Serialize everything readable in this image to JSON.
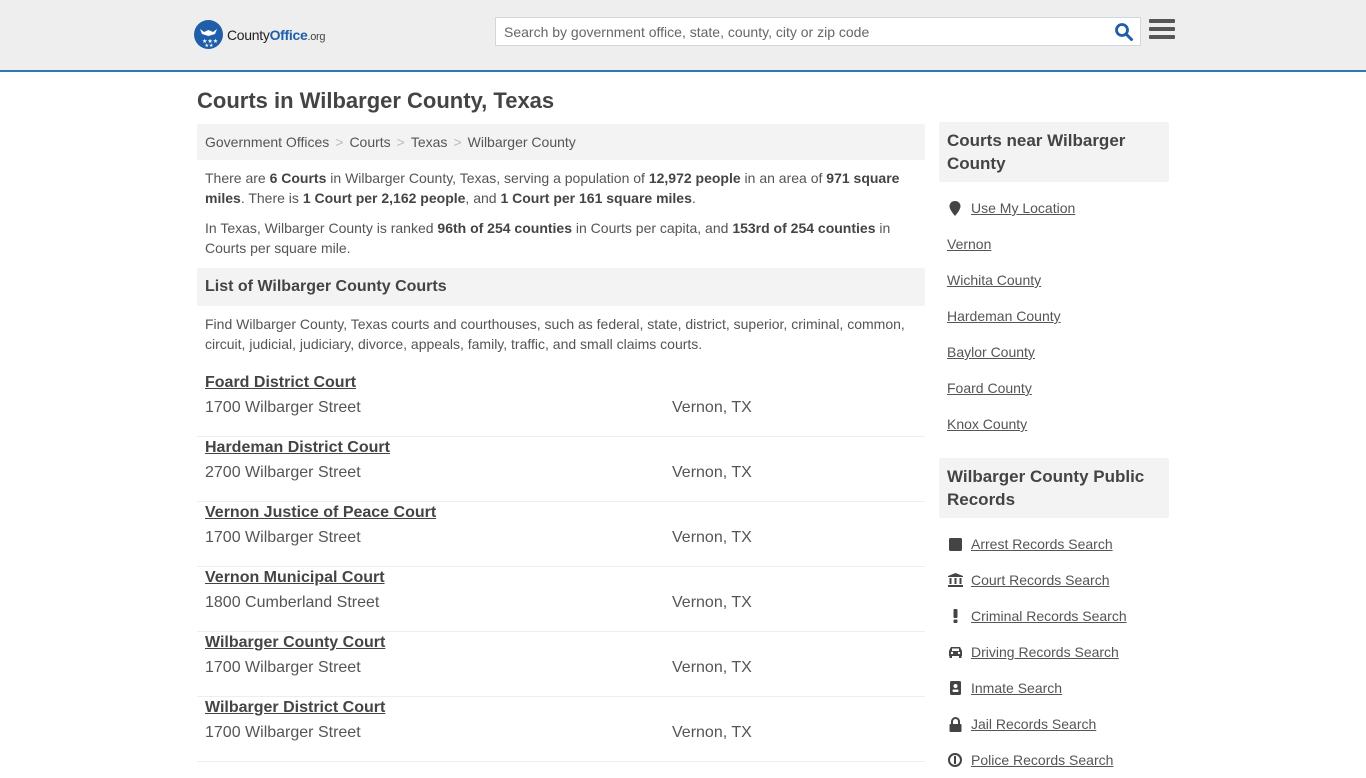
{
  "header": {
    "logo": {
      "county": "County",
      "office": "Office",
      "tld": ".org"
    },
    "search_placeholder": "Search by government office, state, county, city or zip code",
    "search_value": "",
    "brand_color": "#1f5ea8",
    "accent_line_color": "#2d78b5"
  },
  "page_title": "Courts in Wilbarger County, Texas",
  "breadcrumb": [
    {
      "label": "Government Offices"
    },
    {
      "label": "Courts"
    },
    {
      "label": "Texas"
    },
    {
      "label": "Wilbarger County"
    }
  ],
  "intro": {
    "p1": {
      "t1": "There are ",
      "b1": "6 Courts",
      "t2": " in Wilbarger County, Texas, serving a population of ",
      "b2": "12,972 people",
      "t3": " in an area of ",
      "b3": "971 square miles",
      "t4": ". There is ",
      "b4": "1 Court per 2,162 people",
      "t5": ", and ",
      "b5": "1 Court per 161 square miles",
      "t6": "."
    },
    "p2": {
      "t1": "In Texas, Wilbarger County is ranked ",
      "b1": "96th of 254 counties",
      "t2": " in Courts per capita, and ",
      "b2": "153rd of 254 counties",
      "t3": " in Courts per square mile."
    }
  },
  "list_section": {
    "heading": "List of Wilbarger County Courts",
    "description": "Find Wilbarger County, Texas courts and courthouses, such as federal, state, district, superior, criminal, common, circuit, judicial, judiciary, divorce, appeals, family, traffic, and small claims courts.",
    "courts": [
      {
        "name": "Foard District Court",
        "address": "1700 Wilbarger Street",
        "city": "Vernon, TX"
      },
      {
        "name": "Hardeman District Court",
        "address": "2700 Wilbarger Street",
        "city": "Vernon, TX"
      },
      {
        "name": "Vernon Justice of Peace Court",
        "address": "1700 Wilbarger Street",
        "city": "Vernon, TX"
      },
      {
        "name": "Vernon Municipal Court",
        "address": "1800 Cumberland Street",
        "city": "Vernon, TX"
      },
      {
        "name": "Wilbarger County Court",
        "address": "1700 Wilbarger Street",
        "city": "Vernon, TX"
      },
      {
        "name": "Wilbarger District Court",
        "address": "1700 Wilbarger Street",
        "city": "Vernon, TX"
      }
    ]
  },
  "sidebar": {
    "nearby": {
      "heading": "Courts near Wilbarger County",
      "use_location": {
        "label": "Use My Location",
        "icon": "map-marker-icon"
      },
      "links": [
        "Vernon",
        "Wichita County",
        "Hardeman County",
        "Baylor County",
        "Foard County",
        "Knox County"
      ]
    },
    "records": {
      "heading": "Wilbarger County Public Records",
      "links": [
        {
          "label": "Arrest Records Search",
          "icon": "square-icon"
        },
        {
          "label": "Court Records Search",
          "icon": "courthouse-icon"
        },
        {
          "label": "Criminal Records Search",
          "icon": "exclamation-icon"
        },
        {
          "label": "Driving Records Search",
          "icon": "car-icon"
        },
        {
          "label": "Inmate Search",
          "icon": "id-badge-icon"
        },
        {
          "label": "Jail Records Search",
          "icon": "lock-icon"
        },
        {
          "label": "Police Records Search",
          "icon": "police-icon"
        }
      ]
    }
  }
}
